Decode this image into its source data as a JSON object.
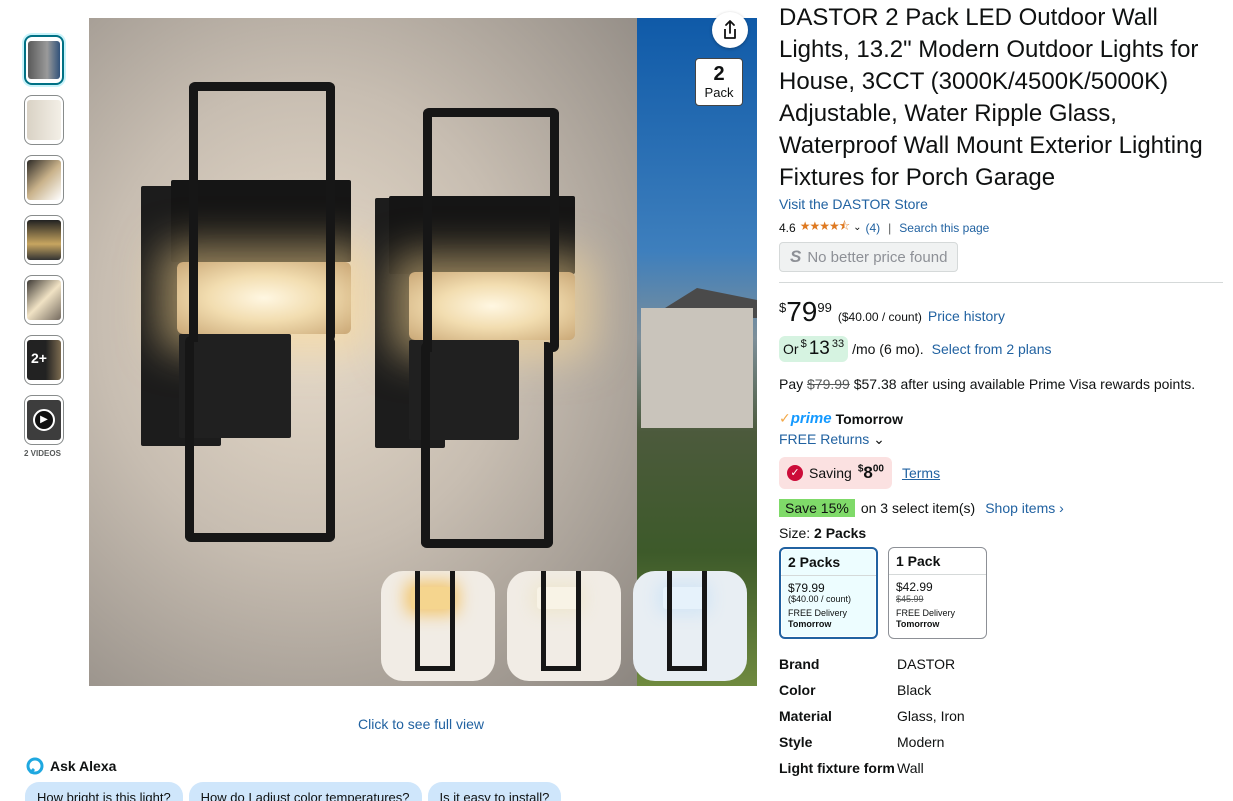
{
  "gallery": {
    "thumbnails": [
      "image-1",
      "image-2",
      "image-3",
      "image-4",
      "image-5",
      "image-6",
      "video"
    ],
    "more_count": "2+",
    "videos_label": "2 VIDEOS",
    "pack_badge": {
      "number": "2",
      "label": "Pack"
    },
    "full_view_link": "Click to see full view"
  },
  "alexa": {
    "label": "Ask Alexa",
    "questions": [
      "How bright is this light?",
      "How do I adjust color temperatures?",
      "Is it easy to install?"
    ]
  },
  "product": {
    "title": "DASTOR 2 Pack LED Outdoor Wall Lights, 13.2\" Modern Outdoor Lights for House, 3CCT (3000K/4500K/5000K) Adjustable, Water Ripple Glass, Waterproof Wall Mount Exterior Lighting Fixtures for Porch Garage",
    "store_link": "Visit the DASTOR Store",
    "rating": "4.6",
    "stars": "★★★★⯪",
    "review_count": "(4)",
    "search_page": "Search this page",
    "no_better_price": "No better price found",
    "no_better_price_icon": "S"
  },
  "pricing": {
    "symbol": "$",
    "whole": "79",
    "fraction": "99",
    "per_count": "($40.00 / count)",
    "price_history": "Price history",
    "monthly_prefix": "Or",
    "monthly_symbol": "$",
    "monthly_whole": "13",
    "monthly_fraction": "33",
    "monthly_suffix": "/mo (6 mo).",
    "plans_link": "Select from 2 plans",
    "pay_prefix": "Pay",
    "pay_original": "$79.99",
    "pay_rest": "$57.38 after using available Prime Visa rewards points."
  },
  "delivery": {
    "prime_logo": "prime",
    "prime_day": "Tomorrow",
    "returns": "FREE Returns"
  },
  "saving": {
    "label": "Saving",
    "symbol": "$",
    "whole": "8",
    "fraction": "00",
    "terms": "Terms"
  },
  "coupon": {
    "badge": "Save 15%",
    "text": "on 3 select item(s)",
    "shop": "Shop items ›"
  },
  "size": {
    "label": "Size:",
    "selected": "2 Packs",
    "options": [
      {
        "name": "2 Packs",
        "price": "$79.99",
        "per": "($40.00 / count)",
        "strike": "",
        "delivery": "FREE Delivery",
        "day": "Tomorrow"
      },
      {
        "name": "1 Pack",
        "price": "$42.99",
        "per": "",
        "strike": "$45.99",
        "delivery": "FREE Delivery",
        "day": "Tomorrow"
      }
    ]
  },
  "specs": [
    {
      "key": "Brand",
      "value": "DASTOR"
    },
    {
      "key": "Color",
      "value": "Black"
    },
    {
      "key": "Material",
      "value": "Glass, Iron"
    },
    {
      "key": "Style",
      "value": "Modern"
    },
    {
      "key": "Light fixture form",
      "value": "Wall"
    }
  ],
  "colors": {
    "link": "#2162a1",
    "star": "#de7921",
    "coupon_green": "#7fda69",
    "saving_pink": "#fbe1e1",
    "installment_green": "#d6f3e1",
    "prime_blue": "#1399ff"
  }
}
